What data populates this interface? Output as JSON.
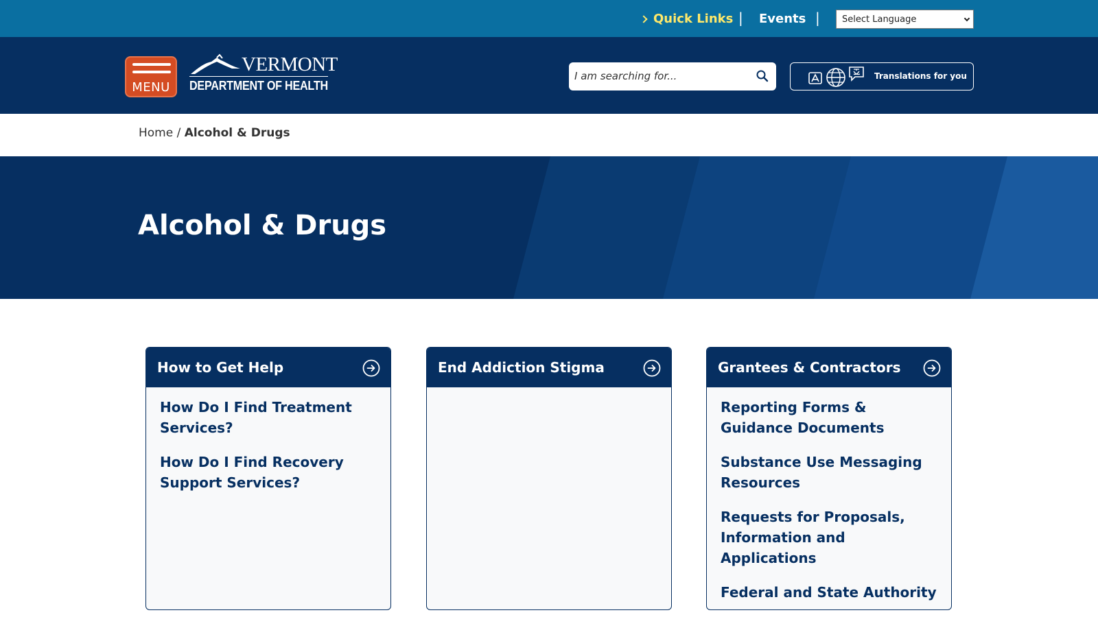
{
  "utility": {
    "quick_links": "Quick Links",
    "separator": "|",
    "events": "Events",
    "language_select": "Select Language"
  },
  "header": {
    "menu_label": "MENU",
    "logo_state": "VERMONT",
    "logo_department": "DEPARTMENT OF HEALTH",
    "search_placeholder": "I am searching for...",
    "translate_label": "Translations for you"
  },
  "breadcrumb": {
    "home": "Home",
    "separator": " / ",
    "current": "Alcohol & Drugs"
  },
  "hero": {
    "title": "Alcohol & Drugs"
  },
  "cards": [
    {
      "title": "How to Get Help",
      "links": [
        "How Do I Find Treatment Services?",
        "How Do I Find Recovery Support Services?"
      ]
    },
    {
      "title": "End Addiction Stigma",
      "links": []
    },
    {
      "title": "Grantees & Contractors",
      "links": [
        "Reporting Forms & Guidance Documents",
        "Substance Use Messaging Resources",
        "Requests for Proposals, Information and Applications",
        "Federal and State Authority"
      ]
    }
  ],
  "colors": {
    "navy": "#062f61",
    "utility_blue": "#0a6fa1",
    "accent_yellow": "#ffe96a",
    "menu_orange": "#d44c23"
  }
}
